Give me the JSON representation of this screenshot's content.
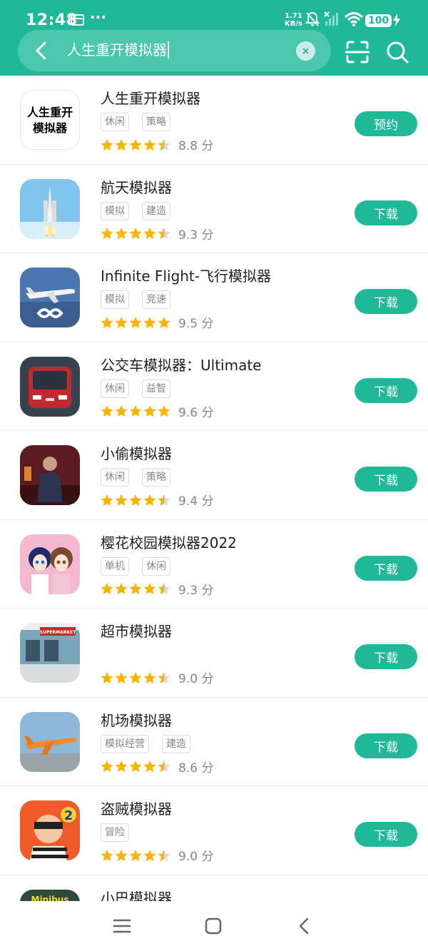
{
  "status_bar": {
    "time": "12:48",
    "speed_value": "1.71",
    "speed_unit": "KB/s",
    "battery": "100"
  },
  "search": {
    "query": "人生重开模拟器"
  },
  "apps": [
    {
      "name": "人生重开模拟器",
      "tags": [
        "休闲",
        "策略"
      ],
      "score": "8.8 分",
      "rating": 4.5,
      "button": "预约",
      "icon": "text-logo-icon",
      "icon_text_1": "人生重开",
      "icon_text_2": "模拟器"
    },
    {
      "name": "航天模拟器",
      "tags": [
        "模拟",
        "建造"
      ],
      "score": "9.3 分",
      "rating": 4.5,
      "button": "下载",
      "icon": "rocket-icon"
    },
    {
      "name": "Infinite Flight-飞行模拟器",
      "tags": [
        "模拟",
        "竞速"
      ],
      "score": "9.5 分",
      "rating": 5,
      "button": "下载",
      "icon": "airplane-icon"
    },
    {
      "name": "公交车模拟器：Ultimate",
      "tags": [
        "休闲",
        "益智"
      ],
      "score": "9.6 分",
      "rating": 5,
      "button": "下载",
      "icon": "bus-icon"
    },
    {
      "name": "小偷模拟器",
      "tags": [
        "休闲",
        "策略"
      ],
      "score": "9.4 分",
      "rating": 4.5,
      "button": "下载",
      "icon": "thief-icon"
    },
    {
      "name": "樱花校园模拟器2022",
      "tags": [
        "单机",
        "休闲"
      ],
      "score": "9.3 分",
      "rating": 4.5,
      "button": "下载",
      "icon": "anime-girls-icon"
    },
    {
      "name": "超市模拟器",
      "tags": [],
      "score": "9.0 分",
      "rating": 4.5,
      "button": "下载",
      "icon": "supermarket-icon",
      "icon_text_1": "SUPERMARKET"
    },
    {
      "name": "机场模拟器",
      "tags": [
        "模拟经营",
        "建造"
      ],
      "score": "8.6 分",
      "rating": 4.5,
      "button": "下载",
      "icon": "airport-icon"
    },
    {
      "name": "盗贼模拟器",
      "tags": [
        "冒险"
      ],
      "score": "9.0 分",
      "rating": 4.5,
      "button": "下载",
      "icon": "robber-icon",
      "icon_text_1": "2"
    },
    {
      "name": "小巴模拟器",
      "tags": [],
      "score": "",
      "rating": 0,
      "button": "",
      "icon": "minibus-icon",
      "icon_text_1": "Minibus"
    }
  ],
  "colors": {
    "accent": "#1fb99a",
    "star": "#f8b400",
    "star_empty": "#d8d8d8"
  }
}
